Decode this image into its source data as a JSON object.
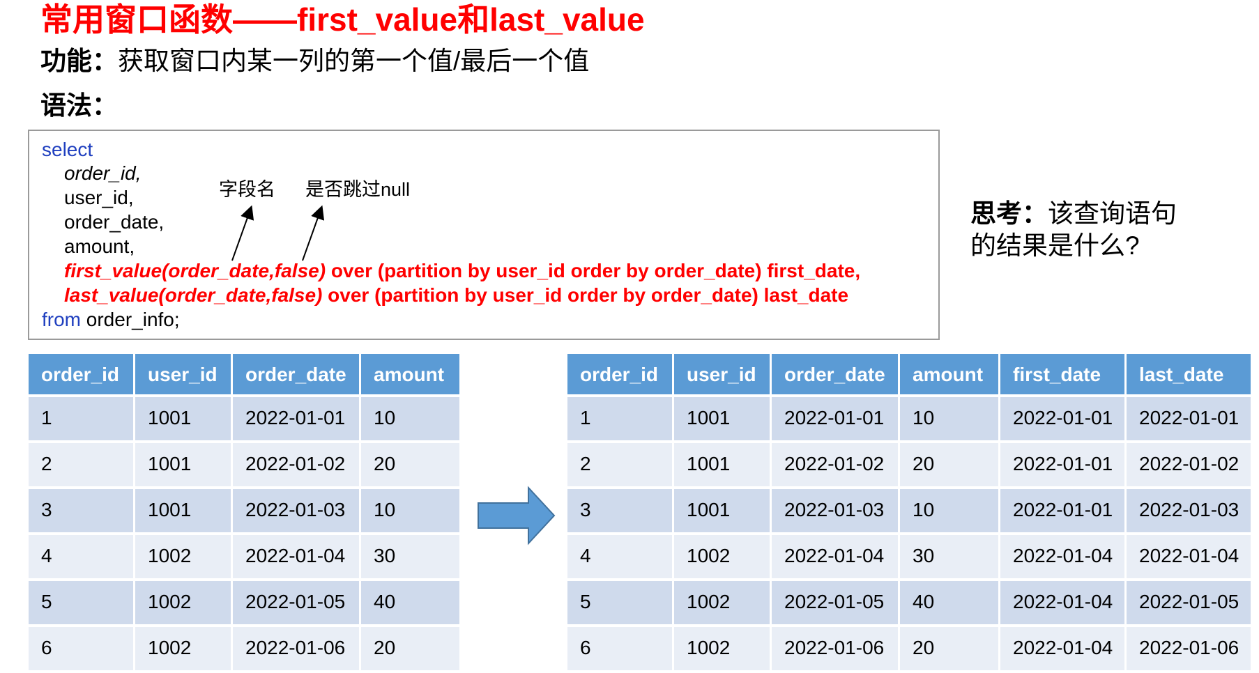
{
  "title": "常用窗口函数——first_value和last_value",
  "function": {
    "label": "功能：",
    "text": "获取窗口内某一列的第一个值/最后一个值"
  },
  "syntax_label": "语法：",
  "code": {
    "select": "select",
    "col1": "order_id,",
    "col2": "user_id,",
    "col3": "order_date,",
    "col4": "amount,",
    "fv_fn": "first_value(order_date,false)",
    "fv_rest": " over (partition by user_id order by order_date) first_date,",
    "lv_fn": "last_value(order_date,false)",
    "lv_rest": " over (partition by user_id order by order_date) last_date",
    "from_kw": "from",
    "from_rest": " order_info;"
  },
  "annotations": {
    "field_name": "字段名",
    "skip_null": "是否跳过null"
  },
  "think": {
    "label": "思考：",
    "text": "该查询语句的结果是什么?"
  },
  "left_table": {
    "headers": [
      "order_id",
      "user_id",
      "order_date",
      "amount"
    ],
    "rows": [
      [
        "1",
        "1001",
        "2022-01-01",
        "10"
      ],
      [
        "2",
        "1001",
        "2022-01-02",
        "20"
      ],
      [
        "3",
        "1001",
        "2022-01-03",
        "10"
      ],
      [
        "4",
        "1002",
        "2022-01-04",
        "30"
      ],
      [
        "5",
        "1002",
        "2022-01-05",
        "40"
      ],
      [
        "6",
        "1002",
        "2022-01-06",
        "20"
      ]
    ]
  },
  "right_table": {
    "headers": [
      "order_id",
      "user_id",
      "order_date",
      "amount",
      "first_date",
      "last_date"
    ],
    "rows": [
      [
        "1",
        "1001",
        "2022-01-01",
        "10",
        "2022-01-01",
        "2022-01-01"
      ],
      [
        "2",
        "1001",
        "2022-01-02",
        "20",
        "2022-01-01",
        "2022-01-02"
      ],
      [
        "3",
        "1001",
        "2022-01-03",
        "10",
        "2022-01-01",
        "2022-01-03"
      ],
      [
        "4",
        "1002",
        "2022-01-04",
        "30",
        "2022-01-04",
        "2022-01-04"
      ],
      [
        "5",
        "1002",
        "2022-01-05",
        "40",
        "2022-01-04",
        "2022-01-05"
      ],
      [
        "6",
        "1002",
        "2022-01-06",
        "20",
        "2022-01-04",
        "2022-01-06"
      ]
    ]
  },
  "colors": {
    "title": "#ff0000",
    "header_bg": "#5b9bd5",
    "row_odd": "#cfdaec",
    "row_even": "#e9eef6",
    "arrow": "#5b9bd5",
    "keyword": "#1f3fbf"
  },
  "arrow_icon": "right-arrow-icon"
}
